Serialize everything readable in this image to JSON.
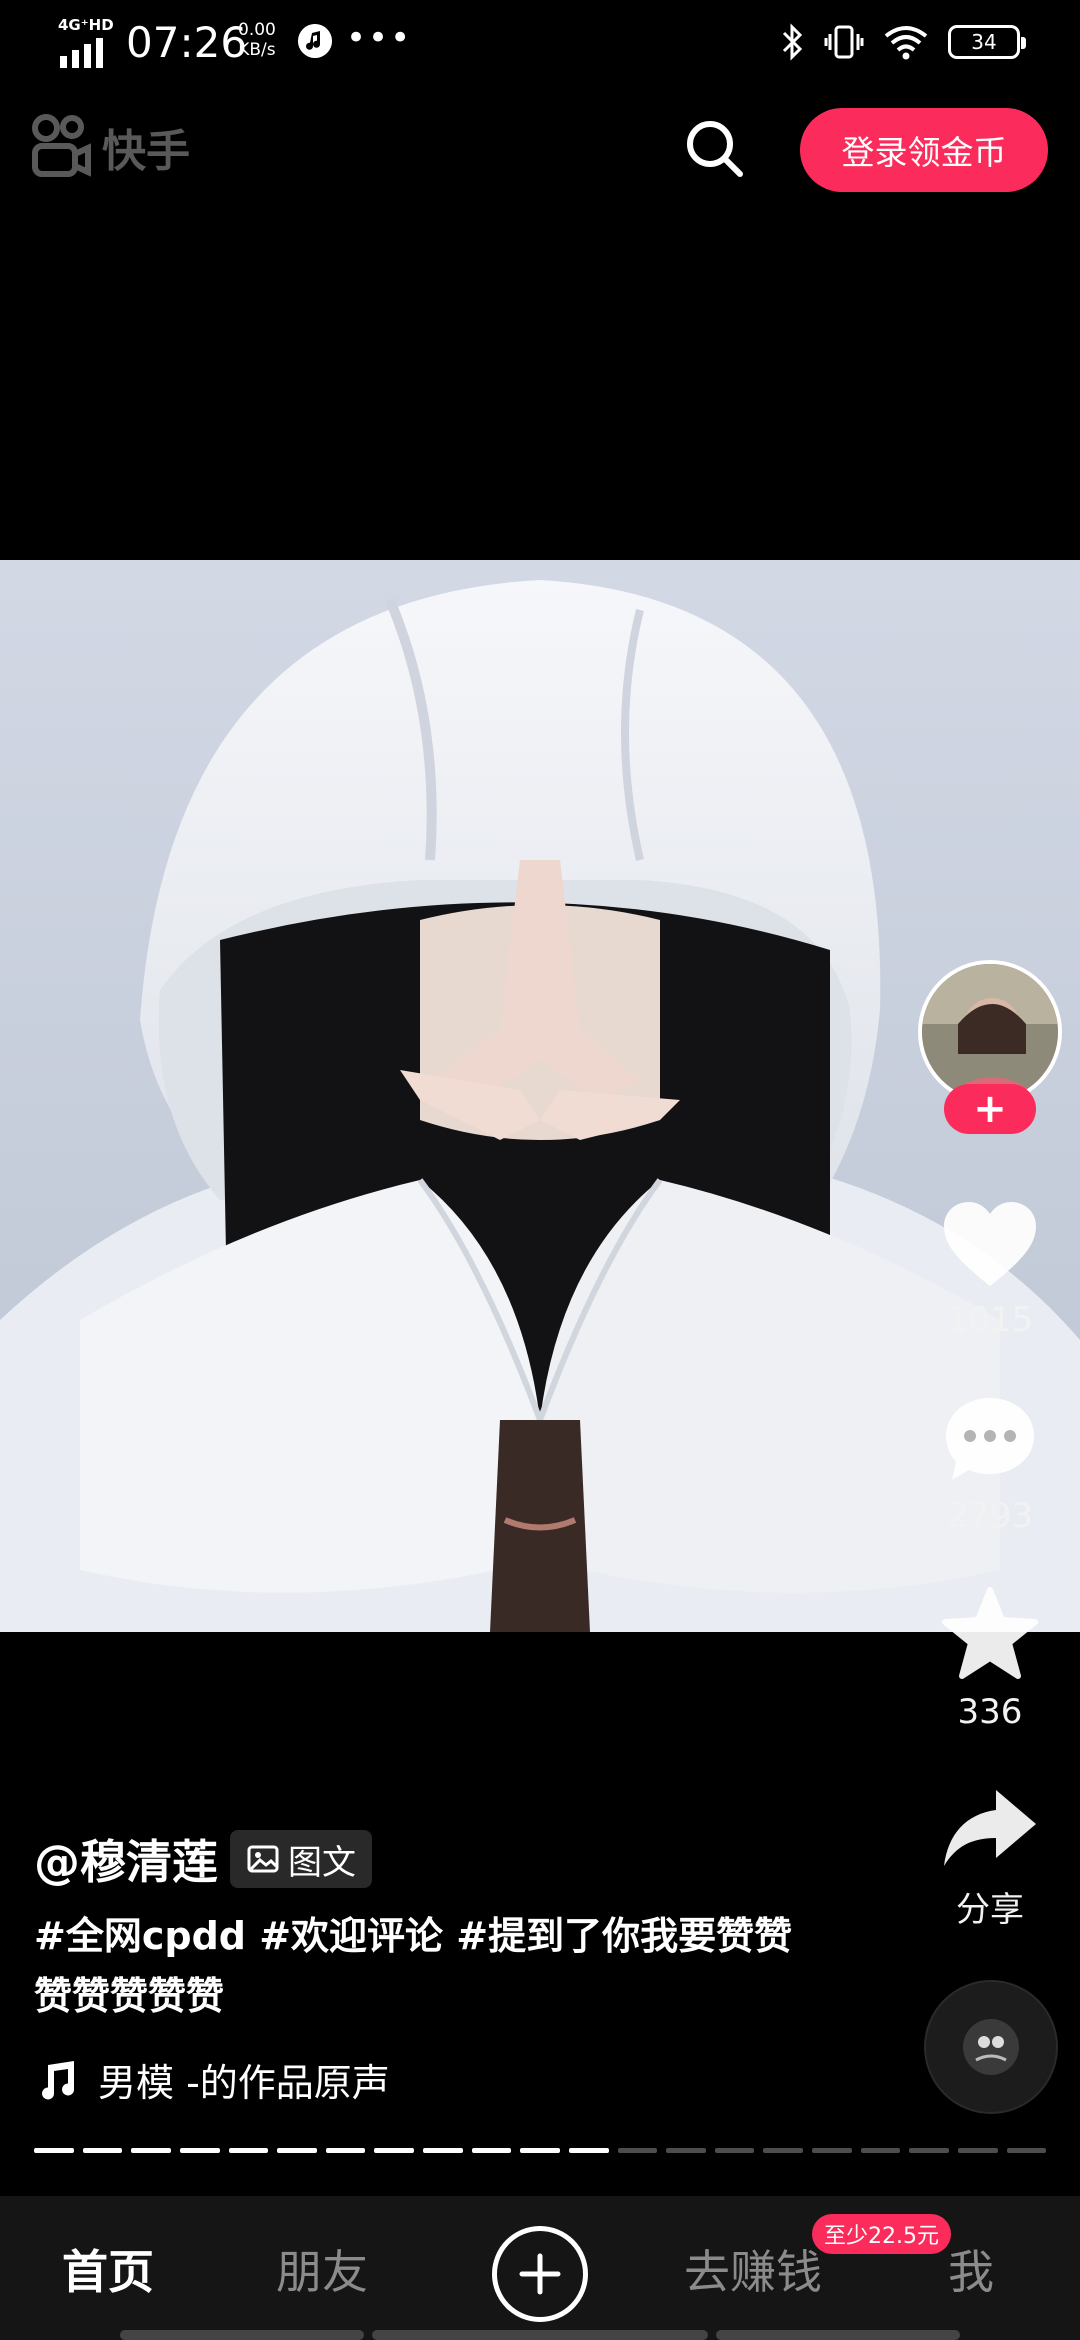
{
  "status_bar": {
    "network": "4G⁺HD",
    "time": "07:26",
    "speed_value": "0.00",
    "speed_unit": "KB/s",
    "more": "•••",
    "battery": "34"
  },
  "top_bar": {
    "logo_text": "快手",
    "login_label": "登录领金币"
  },
  "post": {
    "author": "@穆清莲",
    "type_chip": "图文",
    "caption": "#全网cpdd #欢迎评论 #提到了你我要赞赞赞赞赞赞赞",
    "music": "男模 -的作品原声"
  },
  "rail": {
    "follow": "+",
    "likes": "1015",
    "comments": "2793",
    "favorites": "336",
    "share_label": "分享"
  },
  "progress": {
    "total": 21,
    "current": 12
  },
  "bottom_nav": {
    "home": "首页",
    "friends": "朋友",
    "earn": "去赚钱",
    "earn_badge": "至少22.5元",
    "me": "我"
  },
  "colors": {
    "accent": "#fb2c5c",
    "background": "#000000",
    "nav_background": "#151515"
  }
}
